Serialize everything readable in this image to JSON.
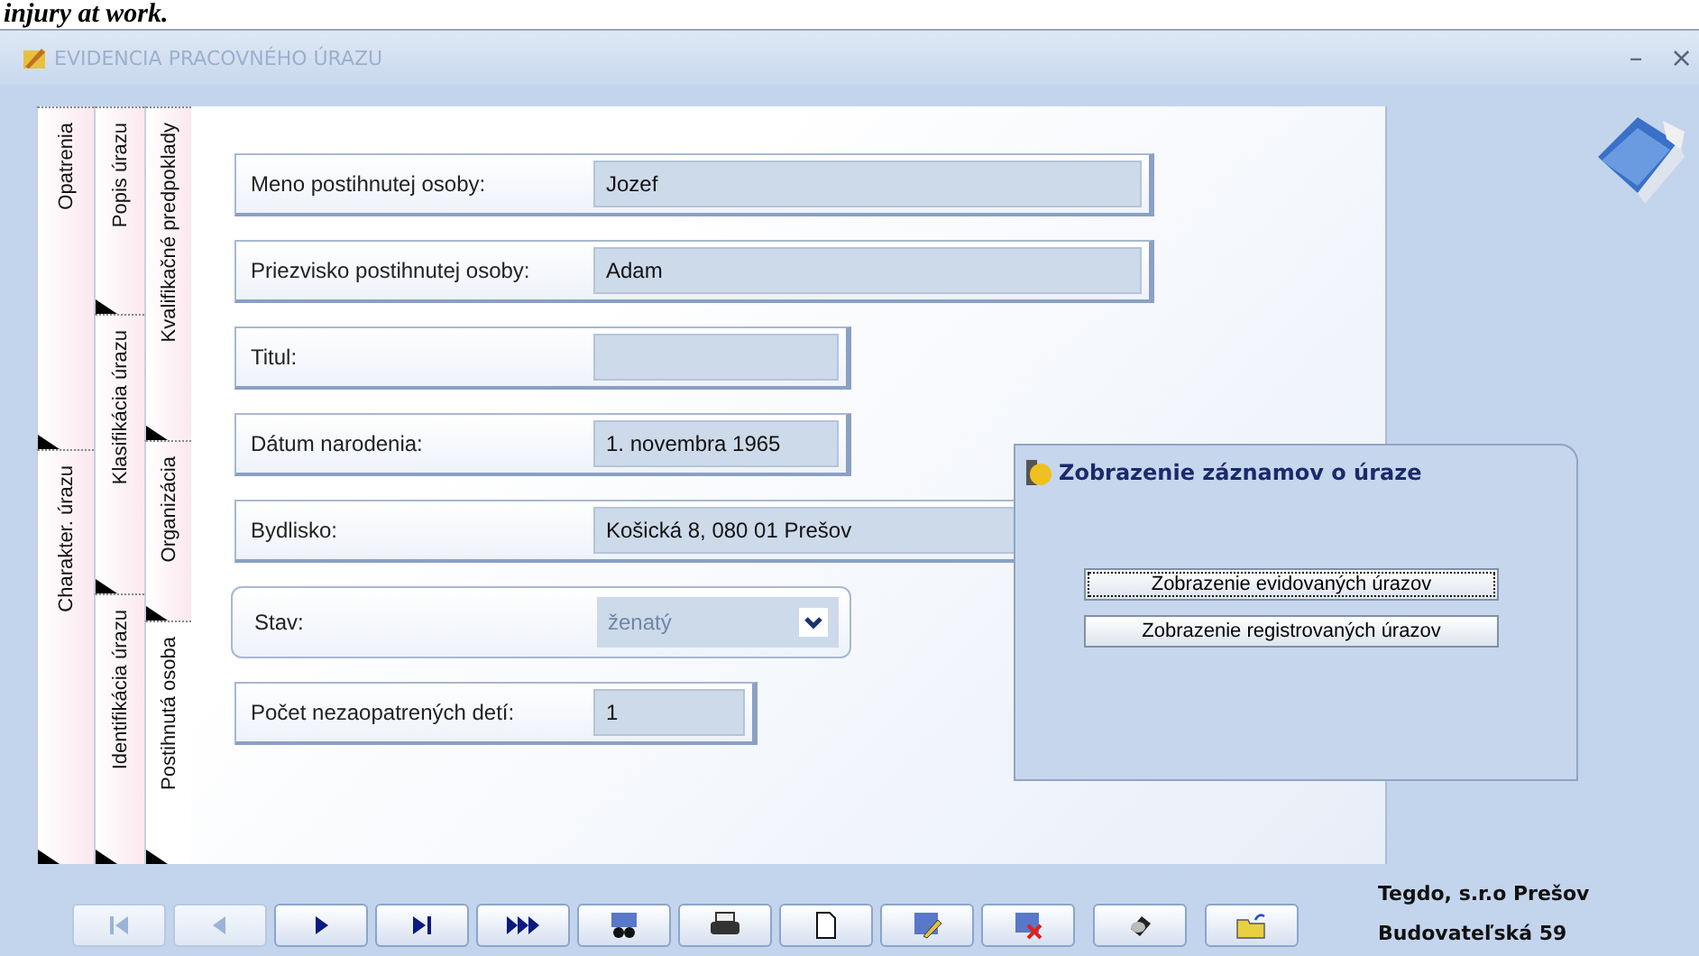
{
  "caption": "injury at work.",
  "window": {
    "title": "EVIDENCIA PRACOVNÉHO ÚRAZU",
    "minimize": "–",
    "close": "×"
  },
  "tab_columns": [
    [
      {
        "label": "Opatrenia",
        "selected": false
      },
      {
        "label": "Charakter. úrazu",
        "selected": false
      }
    ],
    [
      {
        "label": "Popis úrazu",
        "selected": false
      },
      {
        "label": "Klasifikácia úrazu",
        "selected": false
      },
      {
        "label": "Identifikácia úrazu",
        "selected": false
      }
    ],
    [
      {
        "label": "Kvalifikačné predpoklady",
        "selected": false
      },
      {
        "label": "Organizácia",
        "selected": false
      },
      {
        "label": "Postihnutá osoba",
        "selected": true
      }
    ]
  ],
  "form": [
    {
      "kind": "wide",
      "label": "Meno postihnutej osoby:",
      "value": "Jozef"
    },
    {
      "kind": "wide",
      "label": "Priezvisko postihnutej osoby:",
      "value": "Adam"
    },
    {
      "kind": "medium",
      "label": "Titul:"
    },
    {
      "kind": "medium",
      "label": "Dátum narodenia:",
      "value": "1. novembra 1965"
    },
    {
      "kind": "wide",
      "label": "Bydlisko:",
      "value": "Košická 8, 080 01 Prešov"
    },
    {
      "kind": "select",
      "label": "Stav:",
      "value": "ženatý",
      "disabled": true
    },
    {
      "kind": "narrow",
      "label": "Počet nezaopatrených detí:",
      "value": "1"
    }
  ],
  "dialog": {
    "title": "Zobrazenie záznamov o úraze",
    "buttons": [
      {
        "label": "Zobrazenie evidovaných úrazov",
        "focused": true
      },
      {
        "label": "Zobrazenie registrovaných úrazov",
        "focused": false
      }
    ]
  },
  "company": [
    "Tegdo, s.r.o Prešov",
    "Budovateľská  59"
  ],
  "toolbar": [
    {
      "kind": "first",
      "disabled": true
    },
    {
      "kind": "prev",
      "disabled": true
    },
    {
      "kind": "next",
      "disabled": false
    },
    {
      "kind": "last",
      "disabled": false
    },
    {
      "kind": "forward",
      "disabled": false
    },
    {
      "kind": "find",
      "disabled": false
    },
    {
      "kind": "print",
      "disabled": false
    },
    {
      "kind": "new",
      "disabled": false
    },
    {
      "kind": "edit",
      "disabled": false
    },
    {
      "kind": "delete",
      "disabled": false
    },
    {
      "kind": "eraser",
      "disabled": false
    },
    {
      "kind": "open",
      "disabled": false
    }
  ]
}
